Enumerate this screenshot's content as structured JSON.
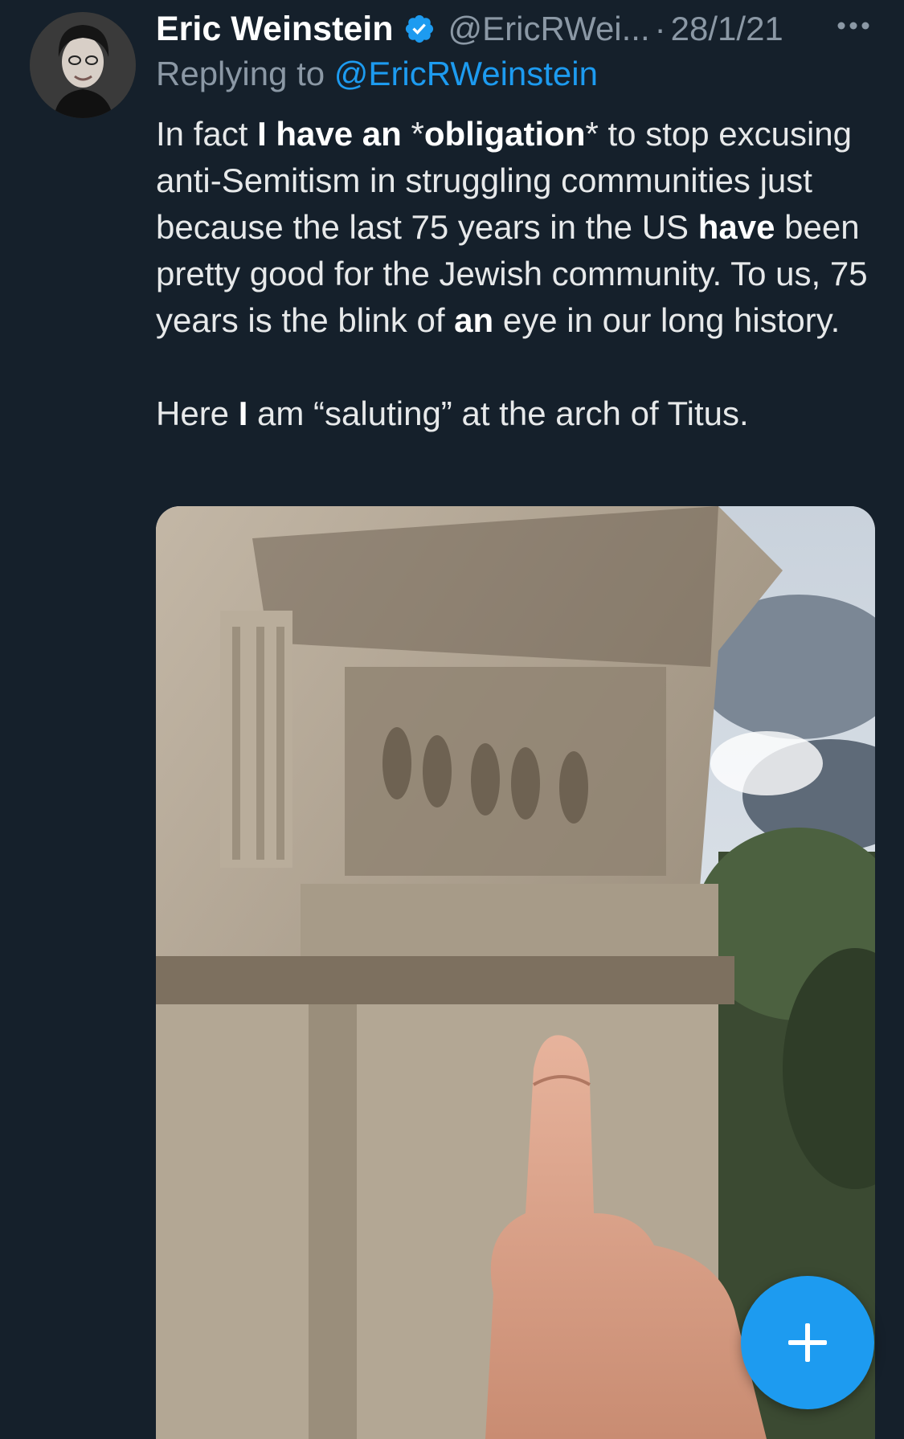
{
  "tweet": {
    "author_name": "Eric Weinstein",
    "author_handle": "@EricRWei...",
    "separator": "·",
    "date": "28/1/21",
    "reply_prefix": "Replying to",
    "reply_handle": "@EricRWeinstein",
    "text_segments": [
      {
        "text": "In fact ",
        "bold": false
      },
      {
        "text": "I have an",
        "bold": true
      },
      {
        "text": " *",
        "bold": false
      },
      {
        "text": "obligation",
        "bold": true
      },
      {
        "text": "* to stop excusing anti-Semitism in struggling communities just because the last 75 years in the US ",
        "bold": false
      },
      {
        "text": "have",
        "bold": true
      },
      {
        "text": " been pretty good for the Jewish community. To us, 75 years is the blink of ",
        "bold": false
      },
      {
        "text": "an",
        "bold": true
      },
      {
        "text": " eye in our long history.",
        "bold": false
      }
    ],
    "text_segments_2": [
      {
        "text": "Here ",
        "bold": false
      },
      {
        "text": "I",
        "bold": true
      },
      {
        "text": " am “saluting” at the arch of Titus.",
        "bold": false
      }
    ]
  },
  "icons": {
    "verified": "verified-badge-icon",
    "more": "more-horizontal-icon",
    "compose": "plus-icon"
  },
  "colors": {
    "background": "#15202b",
    "accent": "#1d9bf0",
    "muted": "#8b98a5"
  }
}
